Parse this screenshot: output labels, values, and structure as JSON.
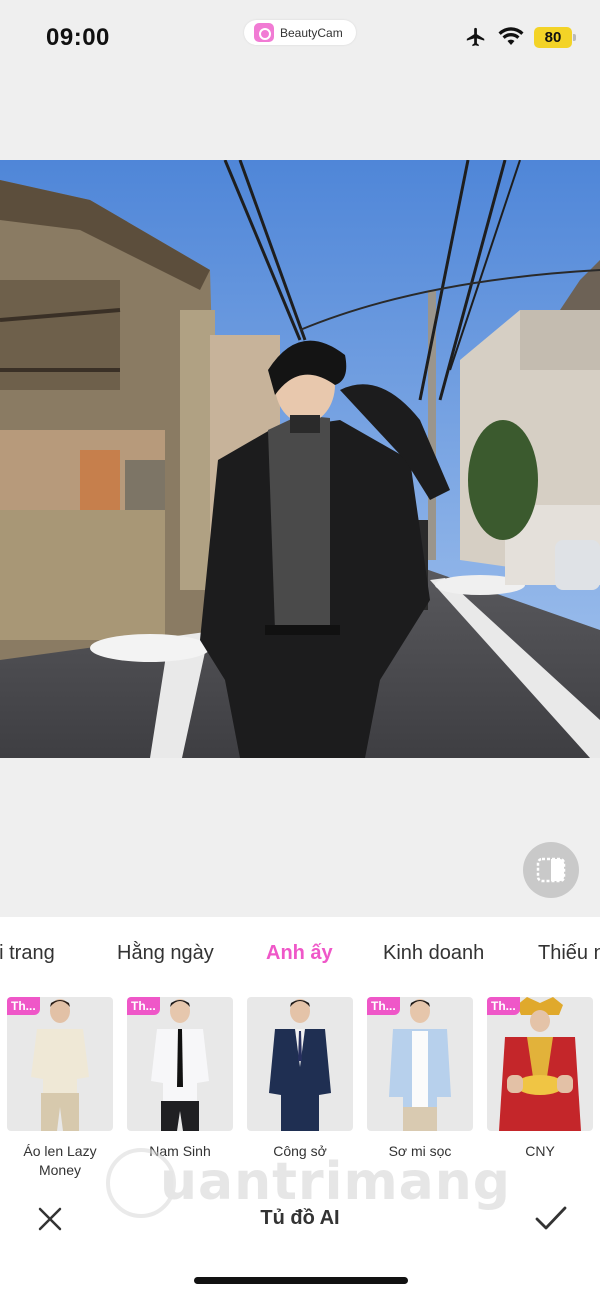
{
  "status_bar": {
    "time": "09:00",
    "app_name": "BeautyCam",
    "battery": "80",
    "icons": [
      "airplane-icon",
      "wifi-icon",
      "battery-icon"
    ]
  },
  "editor": {
    "compare_icon": "compare-icon"
  },
  "categories": [
    "ời trang",
    "Hằng ngày",
    "Anh ấy",
    "Kinh doanh",
    "Thiếu n"
  ],
  "active_category": "Anh ấy",
  "outfits": [
    {
      "label": "Áo len Lazy Money",
      "badge": "Th..."
    },
    {
      "label": "Nam Sinh",
      "badge": "Th..."
    },
    {
      "label": "Công sở",
      "badge": ""
    },
    {
      "label": "Sơ mi sọc",
      "badge": "Th..."
    },
    {
      "label": "CNY",
      "badge": "Th..."
    }
  ],
  "bottom_bar": {
    "title": "Tủ đồ AI",
    "close_icon": "close-icon",
    "confirm_icon": "checkmark-icon"
  },
  "watermark": "uantrimang",
  "colors": {
    "accent": "#ef57c8",
    "battery": "#f3d327",
    "background": "#efefef"
  }
}
